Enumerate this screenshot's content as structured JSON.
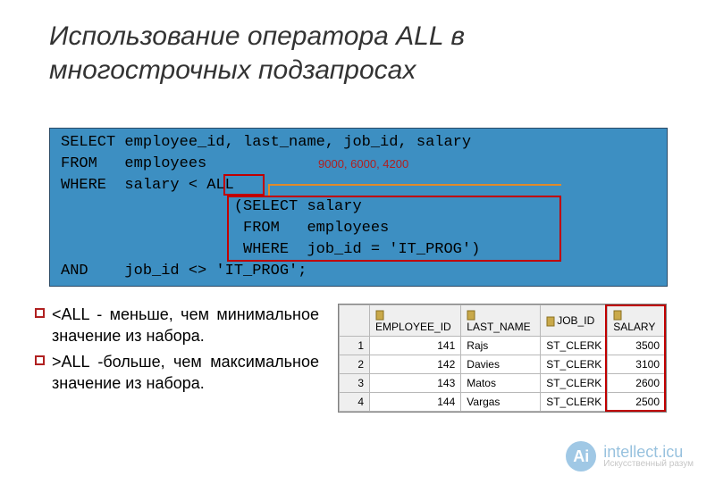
{
  "title": "Использование оператора ALL в многострочных подзапросах",
  "sql": {
    "l1": "SELECT employee_id, last_name, job_id, salary",
    "l2": "FROM   employees",
    "l3": "WHERE  salary < ALL",
    "l4": "                   (SELECT salary",
    "l5": "                    FROM   employees",
    "l6": "                    WHERE  job_id = 'IT_PROG')",
    "l7": "AND    job_id <> 'IT_PROG';"
  },
  "annotation": "9000, 6000, 4200",
  "notes": {
    "b1": "<ALL - меньше, чем минимальное значение из набора.",
    "b2": ">ALL -больше, чем максимальное значение из набора."
  },
  "result": {
    "headers": {
      "rownum": "",
      "c1": "EMPLOYEE_ID",
      "c2": "LAST_NAME",
      "c3": "JOB_ID",
      "c4": "SALARY"
    },
    "rows": [
      {
        "n": "1",
        "emp": "141",
        "name": "Rajs",
        "job": "ST_CLERK",
        "sal": "3500"
      },
      {
        "n": "2",
        "emp": "142",
        "name": "Davies",
        "job": "ST_CLERK",
        "sal": "3100"
      },
      {
        "n": "3",
        "emp": "143",
        "name": "Matos",
        "job": "ST_CLERK",
        "sal": "2600"
      },
      {
        "n": "4",
        "emp": "144",
        "name": "Vargas",
        "job": "ST_CLERK",
        "sal": "2500"
      }
    ]
  },
  "watermark": {
    "logo": "Ai",
    "line1": "intellect.icu",
    "line2": "Искусственный разум"
  }
}
